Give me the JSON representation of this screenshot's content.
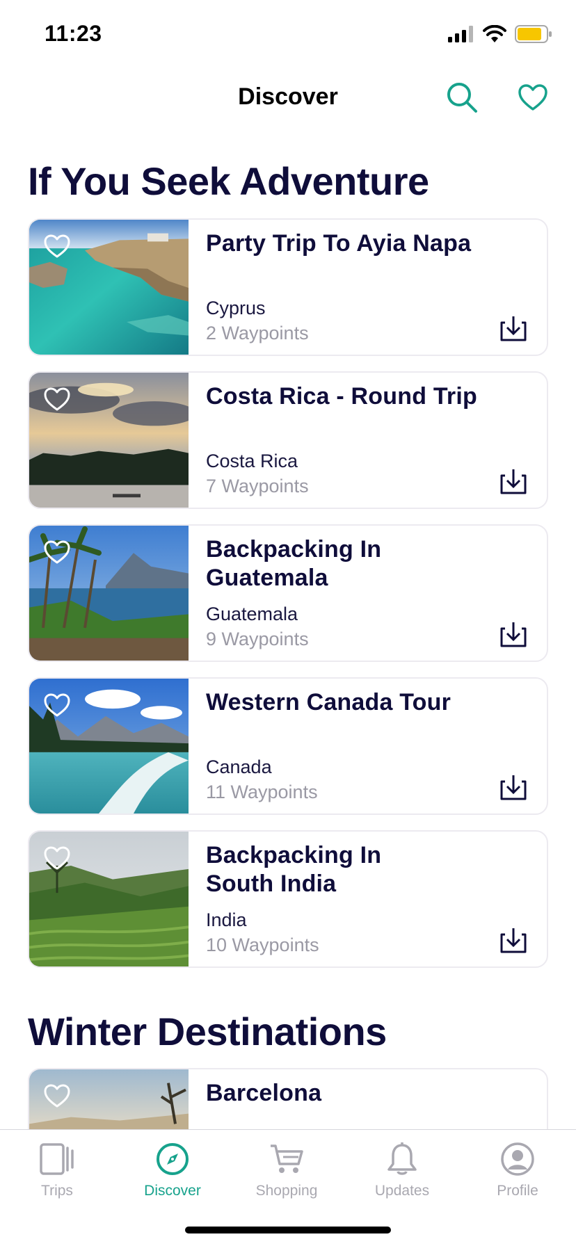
{
  "status": {
    "time": "11:23",
    "battery_color": "#f7c600"
  },
  "header": {
    "title": "Discover",
    "search_icon": "search-icon",
    "favorites_icon": "heart-outline-icon"
  },
  "colors": {
    "accent": "#17a28c",
    "title": "#0f0d3a",
    "muted": "#9a99a4"
  },
  "sections": [
    {
      "title": "If You Seek Adventure",
      "trips": [
        {
          "title": "Party Trip To Ayia Napa",
          "country": "Cyprus",
          "waypoints": "2 Waypoints"
        },
        {
          "title": "Costa Rica - Round Trip",
          "country": "Costa Rica",
          "waypoints": "7 Waypoints"
        },
        {
          "title": "Backpacking In Guatemala",
          "country": "Guatemala",
          "waypoints": "9 Waypoints"
        },
        {
          "title": "Western Canada Tour",
          "country": "Canada",
          "waypoints": "11 Waypoints"
        },
        {
          "title": "Backpacking In South India",
          "country": "India",
          "waypoints": "10 Waypoints"
        }
      ]
    },
    {
      "title": "Winter Destinations",
      "trips": [
        {
          "title": "Barcelona"
        }
      ]
    }
  ],
  "tabs": [
    {
      "label": "Trips",
      "icon": "trips-icon",
      "active": false
    },
    {
      "label": "Discover",
      "icon": "compass-icon",
      "active": true
    },
    {
      "label": "Shopping",
      "icon": "cart-icon",
      "active": false
    },
    {
      "label": "Updates",
      "icon": "bell-icon",
      "active": false
    },
    {
      "label": "Profile",
      "icon": "profile-icon",
      "active": false
    }
  ]
}
